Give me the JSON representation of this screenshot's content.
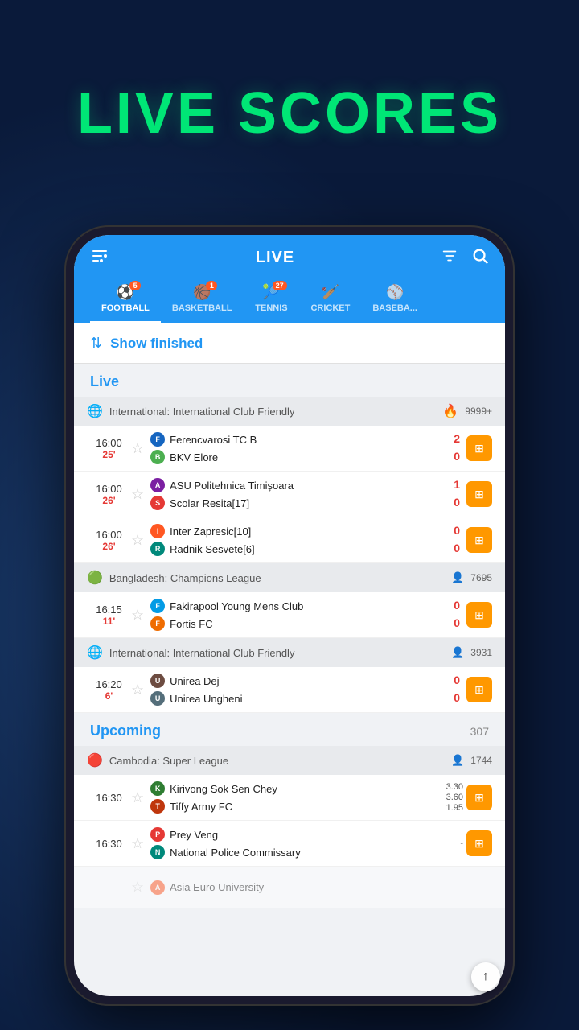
{
  "title": "LIVE SCORES",
  "header": {
    "title": "LIVE",
    "filter_icon": "⚙",
    "search_icon": "🔍"
  },
  "tabs": [
    {
      "id": "football",
      "label": "FOOTBALL",
      "icon": "⚽",
      "badge": "5",
      "active": true
    },
    {
      "id": "basketball",
      "label": "BASKETBALL",
      "icon": "🏀",
      "badge": "1",
      "active": false
    },
    {
      "id": "tennis",
      "label": "TENNIS",
      "icon": "🎾",
      "badge": "27",
      "active": false
    },
    {
      "id": "cricket",
      "label": "CRICKET",
      "icon": "🏏",
      "badge": null,
      "active": false
    },
    {
      "id": "baseball",
      "label": "BASEBA...",
      "icon": "⚾",
      "badge": null,
      "active": false
    }
  ],
  "show_finished": {
    "label": "Show finished"
  },
  "live_section": {
    "label": "Live"
  },
  "leagues": [
    {
      "id": "intl_friendly_1",
      "name": "International: International Club Friendly",
      "icon_type": "globe",
      "viewers": "9999+",
      "viewers_icon": "fire",
      "matches": [
        {
          "time": "16:00",
          "minute": "25'",
          "team1": "Ferencvarosi TC B",
          "team2": "BKV Elore",
          "score1": "2",
          "score2": "0",
          "logo1": "F",
          "logo2": "B",
          "logo1_class": "team-logo-1",
          "logo2_class": "team-logo-2"
        },
        {
          "time": "16:00",
          "minute": "26'",
          "team1": "ASU Politehnica Timișoara",
          "team2": "Scolar Resita[17]",
          "score1": "1",
          "score2": "0",
          "logo1": "A",
          "logo2": "S",
          "logo1_class": "team-logo-3",
          "logo2_class": "team-logo-4"
        },
        {
          "time": "16:00",
          "minute": "26'",
          "team1": "Inter Zapresic[10]",
          "team2": "Radnik Sesvete[6]",
          "score1": "0",
          "score2": "0",
          "logo1": "I",
          "logo2": "R",
          "logo1_class": "team-logo-5",
          "logo2_class": "team-logo-6"
        }
      ]
    },
    {
      "id": "bangladesh_champions",
      "name": "Bangladesh: Champions League",
      "icon_type": "flag",
      "viewers": "7695",
      "viewers_icon": "people",
      "matches": [
        {
          "time": "16:15",
          "minute": "11'",
          "team1": "Fakirapool Young Mens Club",
          "team2": "Fortis FC",
          "score1": "0",
          "score2": "0",
          "logo1": "F",
          "logo2": "F",
          "logo1_class": "team-logo-7",
          "logo2_class": "team-logo-8"
        }
      ]
    },
    {
      "id": "intl_friendly_2",
      "name": "International: International Club Friendly",
      "icon_type": "globe",
      "viewers": "3931",
      "viewers_icon": "people",
      "matches": [
        {
          "time": "16:20",
          "minute": "6'",
          "team1": "Unirea Dej",
          "team2": "Unirea Ungheni",
          "score1": "0",
          "score2": "0",
          "logo1": "U",
          "logo2": "U",
          "logo1_class": "team-logo-9",
          "logo2_class": "team-logo-10"
        }
      ]
    }
  ],
  "upcoming_section": {
    "label": "Upcoming",
    "count": "307"
  },
  "upcoming_leagues": [
    {
      "id": "cambodia_super",
      "name": "Cambodia: Super League",
      "icon_type": "cambodia",
      "viewers": "1744",
      "matches": [
        {
          "time": "16:30",
          "team1": "Kirivong Sok Sen Chey",
          "team2": "Tiffy Army FC",
          "odds1": "3.30",
          "odds_x": "3.60",
          "odds2": "1.95",
          "logo1": "K",
          "logo2": "T",
          "logo1_class": "team-logo-11",
          "logo2_class": "team-logo-12"
        },
        {
          "time": "16:30",
          "team1": "Prey Veng",
          "team2": "National Police Commissary",
          "odds1": "-",
          "odds_x": "-",
          "odds2": "-",
          "logo1": "P",
          "logo2": "N",
          "logo1_class": "team-logo-4",
          "logo2_class": "team-logo-6"
        }
      ]
    }
  ],
  "bottom_partial": {
    "team": "Asia Euro University"
  }
}
